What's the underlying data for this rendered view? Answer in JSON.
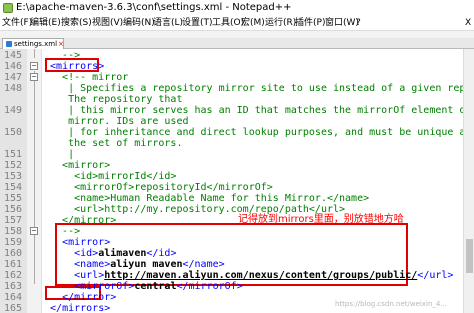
{
  "window": {
    "title": "E:\\apache-maven-3.6.3\\conf\\settings.xml - Notepad++"
  },
  "menu": {
    "items": [
      "文件(F)",
      "编辑(E)",
      "搜索(S)",
      "视图(V)",
      "编码(N)",
      "语言(L)",
      "设置(T)",
      "工具(O)",
      "宏(M)",
      "运行(R)",
      "插件(P)",
      "窗口(W)",
      "?"
    ],
    "close_label": "X"
  },
  "tab": {
    "label": "settings.xml",
    "close": "×"
  },
  "editor": {
    "lines": [
      {
        "num": "145",
        "text": "   -->"
      },
      {
        "num": "146",
        "text": " <mirrors>"
      },
      {
        "num": "147",
        "text": "   <!-- mirror"
      },
      {
        "num": "148",
        "text": "    | Specifies a repository mirror site to use instead of a given repository."
      },
      {
        "num": "",
        "text": "    The repository that"
      },
      {
        "num": "149",
        "text": "    | this mirror serves has an ID that matches the mirrorOf element of this"
      },
      {
        "num": "",
        "text": "    mirror. IDs are used"
      },
      {
        "num": "150",
        "text": "    | for inheritance and direct lookup purposes, and must be unique across"
      },
      {
        "num": "",
        "text": "    the set of mirrors."
      },
      {
        "num": "151",
        "text": "    |"
      },
      {
        "num": "152",
        "text": "   <mirror>"
      },
      {
        "num": "153",
        "text": "     <id>mirrorId</id>"
      },
      {
        "num": "154",
        "text": "     <mirrorOf>repositoryId</mirrorOf>"
      },
      {
        "num": "155",
        "text": "     <name>Human Readable Name for this Mirror.</name>"
      },
      {
        "num": "156",
        "text": "     <url>http://my.repository.com/repo/path</url>"
      },
      {
        "num": "157",
        "text": "   </mirror>"
      },
      {
        "num": "158",
        "text": "   -->"
      },
      {
        "num": "159",
        "text": "   <mirror>"
      },
      {
        "num": "160",
        "text": "     <id>alimaven</id>"
      },
      {
        "num": "161",
        "text": "     <name>aliyun maven</name>"
      },
      {
        "num": "162",
        "text": "     <url>http://maven.aliyun.com/nexus/content/groups/public/</url>"
      },
      {
        "num": "163",
        "text": "     <mirrorOf>central</mirrorOf>"
      },
      {
        "num": "164",
        "text": "   </mirror>"
      },
      {
        "num": "165",
        "text": " </mirrors>"
      },
      {
        "num": "166",
        "text": ""
      }
    ],
    "annotation": "记得放到mirrors里面，别放错地方哈",
    "watermark": "https://blog.csdn.net/weixin_4..."
  },
  "colors": {
    "tag": "#0000ff",
    "comment": "#008000",
    "highlight_border": "#e00000",
    "annotation": "#ff0000"
  }
}
